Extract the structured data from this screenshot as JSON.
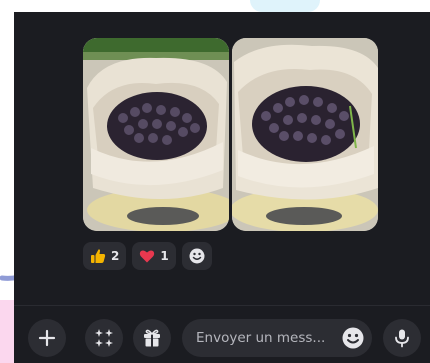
{
  "reactions": [
    {
      "icon": "thumbs-up-icon",
      "count": "2"
    },
    {
      "icon": "heart-icon",
      "count": "1"
    }
  ],
  "composer": {
    "placeholder": "Envoyer un mess..."
  },
  "colors": {
    "panel_bg": "#1b1c21",
    "chip_bg": "#2c2d33",
    "heart": "#e8384f",
    "thumb": "#f4b400",
    "accent_arrow": "#8f9bd6"
  }
}
